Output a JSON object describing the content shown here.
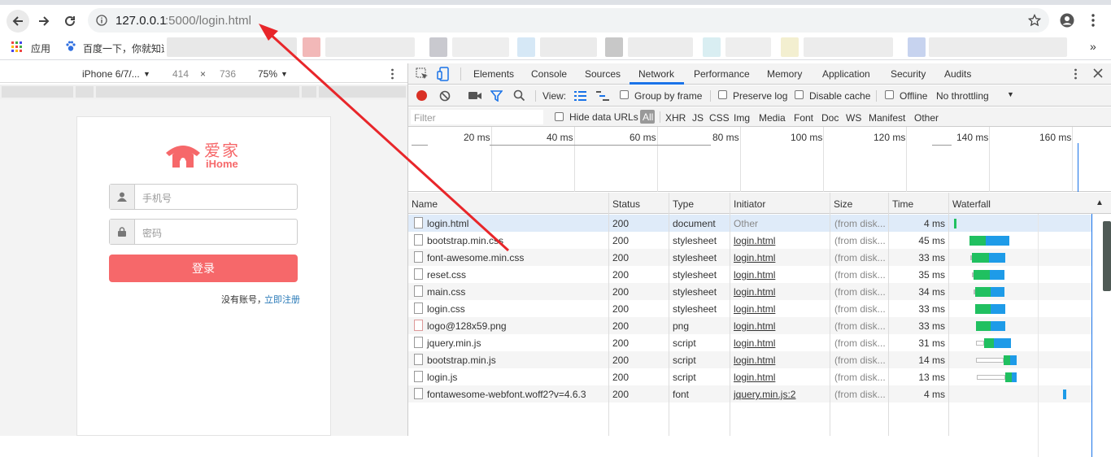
{
  "browser": {
    "url_host": "127.0.0.1",
    "url_path": ":5000/login.html",
    "bookmarks": [
      {
        "label": "应用"
      },
      {
        "label": "百度一下，你就知道"
      }
    ]
  },
  "device_toolbar": {
    "device": "iPhone 6/7/...",
    "width": "414",
    "sep": "×",
    "height": "736",
    "zoom": "75%"
  },
  "login_page": {
    "logo_cn": "爱家",
    "logo_en": "iHome",
    "phone_placeholder": "手机号",
    "password_placeholder": "密码",
    "login_button": "登录",
    "no_account": "没有账号，",
    "register_link": "立即注册",
    "brand_color": "#f6686a"
  },
  "devtools": {
    "tabs": [
      "Elements",
      "Console",
      "Sources",
      "Network",
      "Performance",
      "Memory",
      "Application",
      "Security",
      "Audits"
    ],
    "active_tab": "Network",
    "toolbar": {
      "view_label": "View:",
      "group_by_frame": "Group by frame",
      "preserve_log": "Preserve log",
      "disable_cache": "Disable cache",
      "offline": "Offline",
      "throttling": "No throttling"
    },
    "filter": {
      "placeholder": "Filter",
      "hide_data_urls": "Hide data URLs",
      "types": [
        "All",
        "XHR",
        "JS",
        "CSS",
        "Img",
        "Media",
        "Font",
        "Doc",
        "WS",
        "Manifest",
        "Other"
      ]
    },
    "timeline_ticks": [
      "20 ms",
      "40 ms",
      "60 ms",
      "80 ms",
      "100 ms",
      "120 ms",
      "140 ms",
      "160 ms"
    ],
    "columns": [
      "Name",
      "Status",
      "Type",
      "Initiator",
      "Size",
      "Time",
      "Waterfall"
    ],
    "rows": [
      {
        "name": "login.html",
        "status": "200",
        "type": "document",
        "initiator": "Other",
        "size": "(from disk...",
        "time": "4 ms"
      },
      {
        "name": "bootstrap.min.css",
        "status": "200",
        "type": "stylesheet",
        "initiator": "login.html",
        "size": "(from disk...",
        "time": "45 ms"
      },
      {
        "name": "font-awesome.min.css",
        "status": "200",
        "type": "stylesheet",
        "initiator": "login.html",
        "size": "(from disk...",
        "time": "33 ms"
      },
      {
        "name": "reset.css",
        "status": "200",
        "type": "stylesheet",
        "initiator": "login.html",
        "size": "(from disk...",
        "time": "35 ms"
      },
      {
        "name": "main.css",
        "status": "200",
        "type": "stylesheet",
        "initiator": "login.html",
        "size": "(from disk...",
        "time": "34 ms"
      },
      {
        "name": "login.css",
        "status": "200",
        "type": "stylesheet",
        "initiator": "login.html",
        "size": "(from disk...",
        "time": "33 ms"
      },
      {
        "name": "logo@128x59.png",
        "status": "200",
        "type": "png",
        "initiator": "login.html",
        "size": "(from disk...",
        "time": "33 ms"
      },
      {
        "name": "jquery.min.js",
        "status": "200",
        "type": "script",
        "initiator": "login.html",
        "size": "(from disk...",
        "time": "31 ms"
      },
      {
        "name": "bootstrap.min.js",
        "status": "200",
        "type": "script",
        "initiator": "login.html",
        "size": "(from disk...",
        "time": "14 ms"
      },
      {
        "name": "login.js",
        "status": "200",
        "type": "script",
        "initiator": "login.html",
        "size": "(from disk...",
        "time": "13 ms"
      },
      {
        "name": "fontawesome-webfont.woff2?v=4.6.3",
        "status": "200",
        "type": "font",
        "initiator": "jquery.min.js:2",
        "size": "(from disk...",
        "time": "4 ms"
      }
    ]
  }
}
